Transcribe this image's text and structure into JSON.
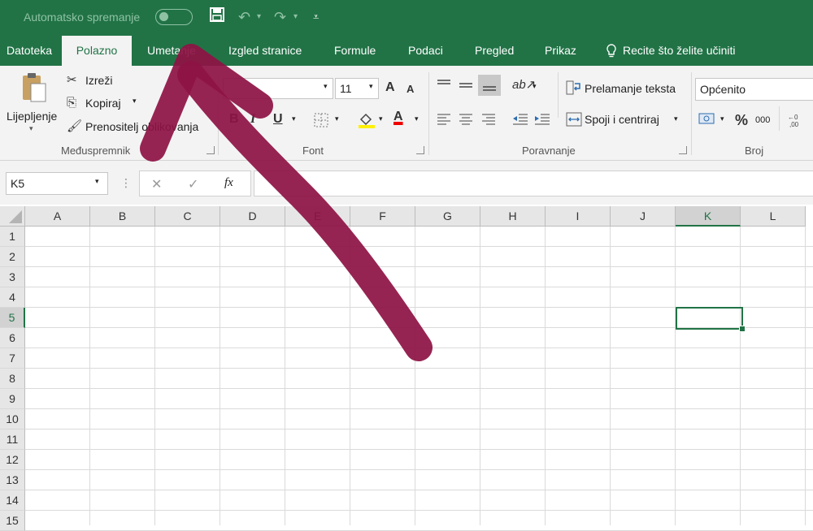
{
  "titlebar": {
    "autosave_label": "Automatsko spremanje",
    "save_icon": "save-icon",
    "undo_icon": "undo-icon",
    "redo_icon": "redo-icon",
    "customize_icon": "customize-qat-icon"
  },
  "tabs": [
    {
      "label": "Datoteka"
    },
    {
      "label": "Polazno",
      "active": true
    },
    {
      "label": "Umetanje"
    },
    {
      "label": "Izgled stranice"
    },
    {
      "label": "Formule"
    },
    {
      "label": "Podaci"
    },
    {
      "label": "Pregled"
    },
    {
      "label": "Prikaz"
    }
  ],
  "tell_me": "Recite što želite učiniti",
  "ribbon": {
    "clipboard": {
      "paste": "Lijepljenje",
      "cut": "Izreži",
      "copy": "Kopiraj",
      "format_painter": "Prenositelj oblikovanja",
      "group_label": "Međuspremnik"
    },
    "font": {
      "size": "11",
      "grow": "A",
      "shrink": "A",
      "bold": "B",
      "italic": "I",
      "underline": "U",
      "font_color": "A",
      "group_label": "Font"
    },
    "alignment": {
      "wrap_text": "Prelamanje teksta",
      "merge_center": "Spoji i centriraj",
      "group_label": "Poravnanje"
    },
    "number": {
      "format": "Općenito",
      "percent": "%",
      "thousands": "000",
      "group_label": "Broj"
    }
  },
  "formula_bar": {
    "name_box": "K5",
    "cancel": "✕",
    "enter": "✓",
    "fx": "fx",
    "value": ""
  },
  "grid": {
    "columns": [
      "A",
      "B",
      "C",
      "D",
      "E",
      "F",
      "G",
      "H",
      "I",
      "J",
      "K",
      "L"
    ],
    "rows": [
      "1",
      "2",
      "3",
      "4",
      "5",
      "6",
      "7",
      "8",
      "9",
      "10",
      "11",
      "12",
      "13",
      "14",
      "15"
    ],
    "selected_column": "K",
    "selected_row": "5"
  },
  "colors": {
    "excel_green": "#217346",
    "annotation_arrow": "#8e1345"
  }
}
